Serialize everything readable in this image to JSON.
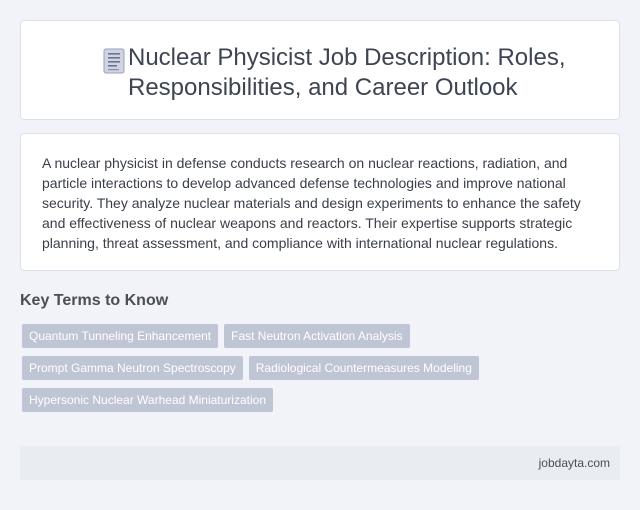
{
  "header": {
    "icon": "document-icon",
    "title": "Nuclear Physicist Job Description: Roles, Responsibilities, and Career Outlook"
  },
  "description": "A nuclear physicist in defense conducts research on nuclear reactions, radiation, and particle interactions to develop advanced defense technologies and improve national security. They analyze nuclear materials and design experiments to enhance the safety and effectiveness of nuclear weapons and reactors. Their expertise supports strategic planning, threat assessment, and compliance with international nuclear regulations.",
  "key_terms": {
    "heading": "Key Terms to Know",
    "tags": [
      "Quantum Tunneling Enhancement",
      "Fast Neutron Activation Analysis",
      "Prompt Gamma Neutron Spectroscopy",
      "Radiological Countermeasures Modeling",
      "Hypersonic Nuclear Warhead Miniaturization"
    ]
  },
  "footer": {
    "site": "jobdayta.com"
  },
  "colors": {
    "background": "#f1f3f8",
    "tag_background": "#c0c5d6",
    "footer_background": "#e9edf1"
  }
}
